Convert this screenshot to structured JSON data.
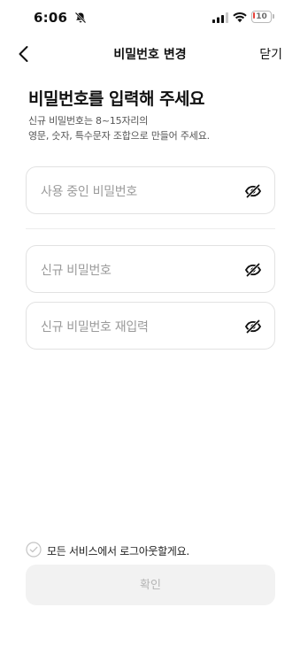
{
  "status_bar": {
    "time": "6:06",
    "battery_level": "10",
    "battery_color": "#e8423a"
  },
  "nav": {
    "title": "비밀번호 변경",
    "close_label": "닫기"
  },
  "headline": "비밀번호를 입력해 주세요",
  "description": "신규 비밀번호는 8~15자리의\n영문, 숫자, 특수문자 조합으로 만들어 주세요.",
  "fields": {
    "current_password_placeholder": "사용 중인 비밀번호",
    "new_password_placeholder": "신규 비밀번호",
    "confirm_password_placeholder": "신규 비밀번호 재입력"
  },
  "logout_all": {
    "label": "모든 서비스에서 로그아웃할게요.",
    "checked": false
  },
  "confirm_button": {
    "label": "확인"
  },
  "icons": {
    "back": "chevron-left-icon",
    "visibility": "eye-off-icon",
    "checkbox": "check-circle-icon"
  }
}
